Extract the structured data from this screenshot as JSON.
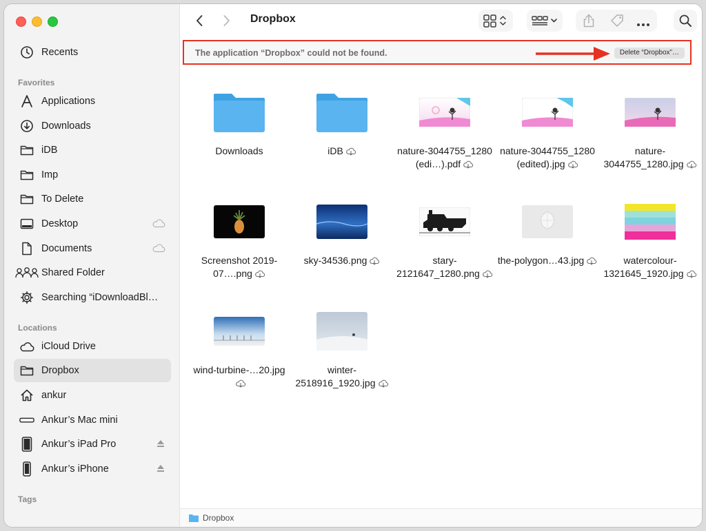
{
  "sidebar": {
    "items": [
      {
        "label": "Recents",
        "icon": "clock-icon"
      },
      {
        "label": "Applications",
        "icon": "applications-icon"
      },
      {
        "label": "Downloads",
        "icon": "download-icon"
      },
      {
        "label": "iDB",
        "icon": "folder-icon"
      },
      {
        "label": "Imp",
        "icon": "folder-icon"
      },
      {
        "label": "To Delete",
        "icon": "folder-icon"
      },
      {
        "label": "Desktop",
        "icon": "desktop-icon"
      },
      {
        "label": "Documents",
        "icon": "document-icon"
      },
      {
        "label": "Shared Folder",
        "icon": "shared-folder-icon"
      },
      {
        "label": "Searching “iDownloadBl…",
        "icon": "gear-icon"
      },
      {
        "label": "iCloud Drive",
        "icon": "cloud-icon"
      },
      {
        "label": "Dropbox",
        "icon": "folder-icon"
      },
      {
        "label": "ankur",
        "icon": "home-icon"
      },
      {
        "label": "Ankur’s Mac mini",
        "icon": "mac-mini-icon"
      },
      {
        "label": "Ankur’s iPad Pro",
        "icon": "ipad-icon"
      },
      {
        "label": "Ankur’s iPhone",
        "icon": "iphone-icon"
      }
    ],
    "sections": {
      "favorites": "Favorites",
      "locations": "Locations",
      "tags": "Tags"
    }
  },
  "toolbar": {
    "title": "Dropbox"
  },
  "banner": {
    "message": "The application “Dropbox” could not be found.",
    "button_label": "Delete “Dropbox”…"
  },
  "files": [
    {
      "name": "Downloads",
      "kind": "folder",
      "cloud": false
    },
    {
      "name": "iDB",
      "kind": "folder",
      "cloud": true
    },
    {
      "name": "nature-3044755_1280 (edi…).pdf",
      "kind": "nature1",
      "cloud": true
    },
    {
      "name": "nature-3044755_1280 (edited).jpg",
      "kind": "nature2",
      "cloud": true
    },
    {
      "name": "nature-3044755_1280.jpg",
      "kind": "nature3",
      "cloud": true
    },
    {
      "name": "Screenshot 2019-07….png",
      "kind": "pineapple",
      "cloud": true
    },
    {
      "name": "sky-34536.png",
      "kind": "sky",
      "cloud": true
    },
    {
      "name": "stary-2121647_1280.png",
      "kind": "train",
      "cloud": true
    },
    {
      "name": "the-polygon…43.jpg",
      "kind": "polygon",
      "cloud": true
    },
    {
      "name": "watercolour-1321645_1920.jpg",
      "kind": "watercolour",
      "cloud": true
    },
    {
      "name": "wind-turbine-…20.jpg",
      "kind": "turbine",
      "cloud": true
    },
    {
      "name": "winter-2518916_1920.jpg",
      "kind": "winter",
      "cloud": true
    }
  ],
  "statusbar": {
    "path": "Dropbox"
  },
  "colors": {
    "accent": "#e53222",
    "folder": "#5ab4ef"
  }
}
